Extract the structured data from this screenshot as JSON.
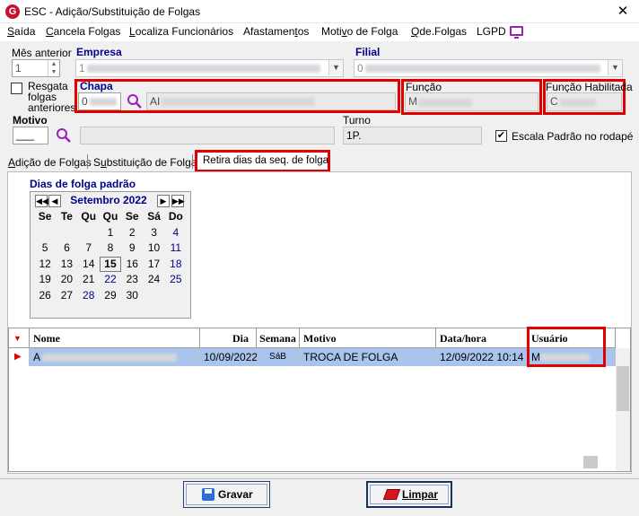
{
  "window": {
    "title": "ESC -  Adição/Substituição de Folgas",
    "close": "✕"
  },
  "menu": {
    "items": [
      {
        "pre": "",
        "u": "S",
        "post": "aída"
      },
      {
        "pre": "",
        "u": "C",
        "post": "ancela Folgas"
      },
      {
        "pre": "",
        "u": "L",
        "post": "ocaliza Funcionários"
      },
      {
        "pre": "Afastamen",
        "u": "t",
        "post": "os"
      },
      {
        "pre": "Moti",
        "u": "v",
        "post": "o de Folga"
      },
      {
        "pre": "",
        "u": "Q",
        "post": "de.Folgas"
      },
      {
        "pre": "LGPD",
        "u": "",
        "post": ""
      }
    ]
  },
  "form": {
    "mes_anterior_label": "Mês anterior",
    "mes_anterior_value": "1",
    "empresa_label": "Empresa",
    "empresa_value": "1",
    "filial_label": "Filial",
    "filial_value": "0",
    "resgata_label_1": "Resgata",
    "resgata_label_2": "folgas",
    "resgata_label_3": "anteriores",
    "chapa_label": "Chapa",
    "chapa_value": "0",
    "nome_value": "AI",
    "funcao_label": "Função",
    "funcao_value": "M",
    "funcao_hab_label": "Função Habilitada",
    "funcao_hab_value": "C",
    "motivo_label": "Motivo",
    "motivo_value": "___",
    "turno_label": "Turno",
    "turno_value": "1P.",
    "escala_label": "Escala Padrão no rodapé",
    "escala_checked": "✔"
  },
  "tabs": {
    "adicao": {
      "pre": "",
      "u": "A",
      "post": "dição de Folgas"
    },
    "substituicao": {
      "pre": "S",
      "u": "u",
      "post": "bstituição de Folgas"
    },
    "retira": "Retira dias da seq. de folga"
  },
  "calendar": {
    "section_title": "Dias de folga padrão",
    "month_title": "Setembro 2022",
    "weekdays": [
      "Se",
      "Te",
      "Qu",
      "Qu",
      "Se",
      "Sá",
      "Do"
    ],
    "weeks": [
      [
        "",
        "",
        "",
        "1",
        "2",
        "3",
        "4"
      ],
      [
        "5",
        "6",
        "7",
        "8",
        "9",
        "10",
        "11"
      ],
      [
        "12",
        "13",
        "14",
        "15",
        "16",
        "17",
        "18"
      ],
      [
        "19",
        "20",
        "21",
        "22",
        "23",
        "24",
        "25"
      ],
      [
        "26",
        "27",
        "28",
        "29",
        "30",
        "",
        ""
      ]
    ],
    "today": "15",
    "highlight_blue": [
      "4",
      "11",
      "18",
      "22",
      "25",
      "28"
    ]
  },
  "grid": {
    "columns": [
      "Nome",
      "Dia",
      "Semana",
      "Motivo",
      "Data/hora",
      "Usuário"
    ],
    "rows": [
      {
        "nome": "A",
        "dia": "10/09/2022",
        "semana": "SáB",
        "motivo": "TROCA DE FOLGA",
        "datahora": "12/09/2022 10:14",
        "usuario": "M"
      }
    ]
  },
  "buttons": {
    "gravar": "Gravar",
    "limpar": "Limpar"
  }
}
